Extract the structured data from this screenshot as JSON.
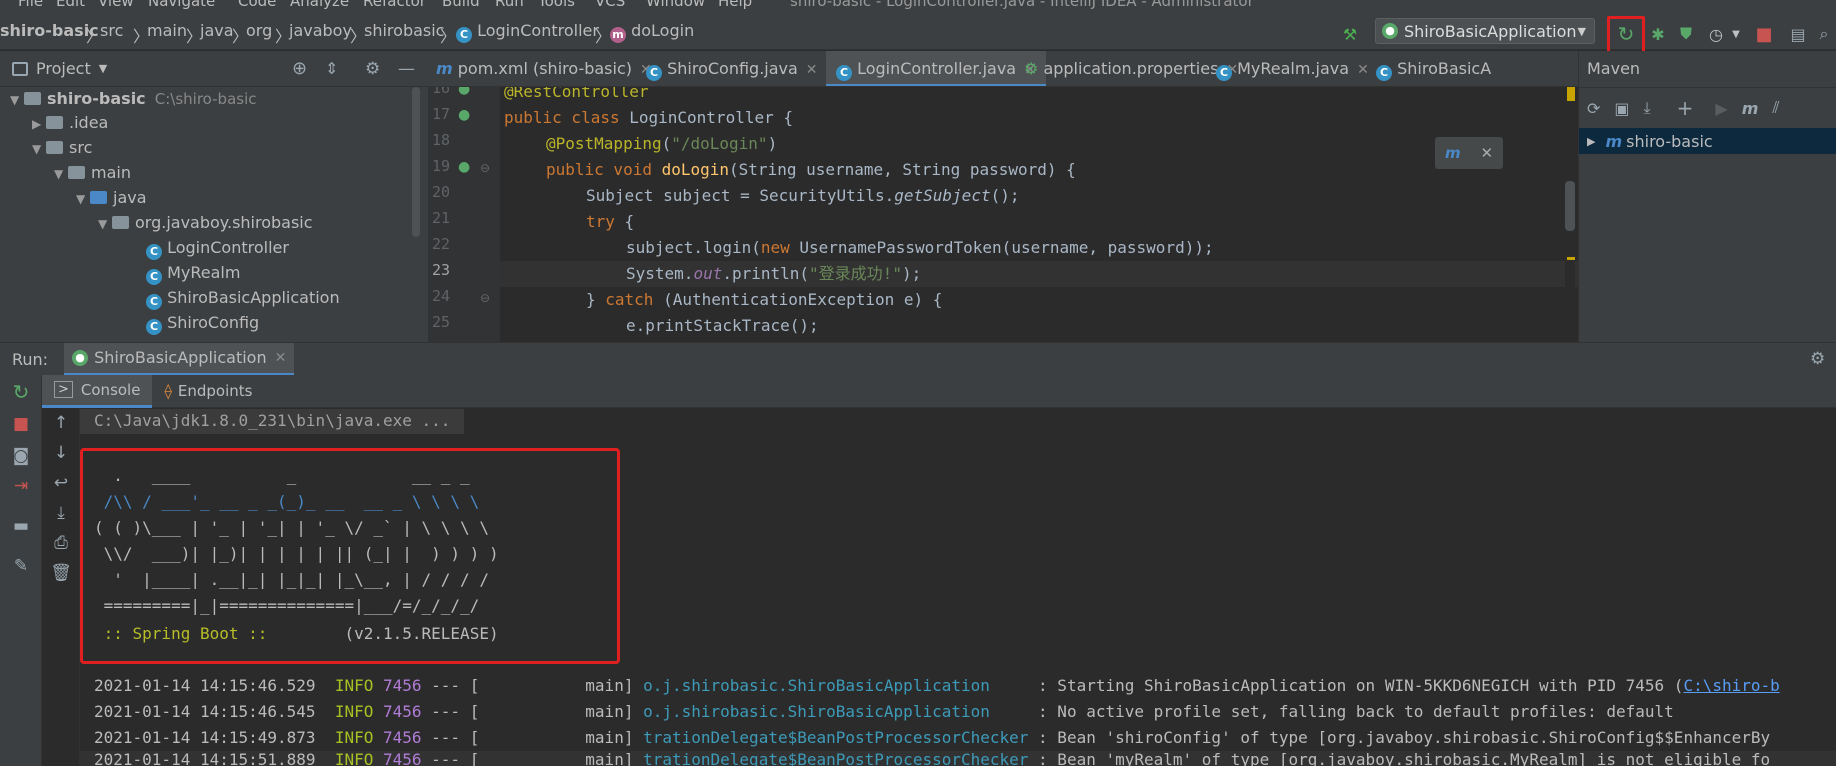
{
  "menu": [
    "File",
    "Edit",
    "View",
    "Navigate",
    "Code",
    "Analyze",
    "Refactor",
    "Build",
    "Run",
    "Tools",
    "VCS",
    "Window",
    "Help"
  ],
  "window_title": "shiro-basic - LoginController.java - IntelliJ IDEA - Administrator",
  "breadcrumb": [
    "shiro-basic",
    "src",
    "main",
    "java",
    "org",
    "javaboy",
    "shirobasic",
    "LoginController",
    "doLogin"
  ],
  "run_config": "ShiroBasicApplication",
  "project": {
    "header": "Project",
    "root_name": "shiro-basic",
    "root_path": "C:\\shiro-basic",
    "items": [
      ".idea",
      "src",
      "main",
      "java",
      "org.javaboy.shirobasic",
      "LoginController",
      "MyRealm",
      "ShiroBasicApplication",
      "ShiroConfig"
    ]
  },
  "editor": {
    "tabs": [
      "pom.xml (shiro-basic)",
      "ShiroConfig.java",
      "LoginController.java",
      "application.properties",
      "MyRealm.java",
      "ShiroBasicA"
    ],
    "line_numbers": [
      "16",
      "17",
      "18",
      "19",
      "20",
      "21",
      "22",
      "23",
      "24",
      "25"
    ],
    "lines": {
      "l16": "@RestController",
      "l17a": "public class ",
      "l17b": "LoginController {",
      "l18a": "@PostMapping",
      "l18b": "(",
      "l18c": "\"/doLogin\"",
      "l18d": ")",
      "l19a": "public void ",
      "l19b": "doLogin",
      "l19c": "(String username, String password) {",
      "l20a": "Subject subject = SecurityUtils.",
      "l20b": "getSubject",
      "l20c": "();",
      "l21a": "try ",
      "l21b": "{",
      "l22a": "subject.login(",
      "l22b": "new ",
      "l22c": "UsernamePasswordToken(username, password));",
      "l23a": "System.",
      "l23b": "out",
      "l23c": ".println(",
      "l23d": "\"登录成功!\"",
      "l23e": ");",
      "l24a": "} ",
      "l24b": "catch ",
      "l24c": "(AuthenticationException e) {",
      "l25": "e.printStackTrace();"
    }
  },
  "maven": {
    "title": "Maven",
    "project": "shiro-basic"
  },
  "run": {
    "label": "Run:",
    "tab": "ShiroBasicApplication",
    "subtabs": [
      "Console",
      "Endpoints"
    ],
    "command": "C:\\Java\\jdk1.8.0_231\\bin\\java.exe ...",
    "banner": [
      "  .   ____          _            __ _ _",
      " /\\\\ / ___'_ __ _ _(_)_ __  __ _ \\ \\ \\ \\",
      "( ( )\\___ | '_ | '_| | '_ \\/ _` | \\ \\ \\ \\",
      " \\\\/  ___)| |_)| | | | | || (_| |  ) ) ) )",
      "  '  |____| .__|_| |_|_| |_\\__, | / / / /",
      " =========|_|==============|___/=/_/_/_/"
    ],
    "spring_label": " :: Spring Boot :: ",
    "spring_version": "       (v2.1.5.RELEASE)",
    "logs": [
      {
        "ts": "2021-01-14 14:15:46.529",
        "lvl": "INFO",
        "pid": "7456",
        "thr": " --- [           main] ",
        "cls": "o.j.shirobasic.ShiroBasicApplication    ",
        "msg": " : Starting ShiroBasicApplication on WIN-5KKD6NEGICH with PID 7456 (",
        "link": "C:\\shiro-b"
      },
      {
        "ts": "2021-01-14 14:15:46.545",
        "lvl": "INFO",
        "pid": "7456",
        "thr": " --- [           main] ",
        "cls": "o.j.shirobasic.ShiroBasicApplication    ",
        "msg": " : No active profile set, falling back to default profiles: default",
        "link": ""
      },
      {
        "ts": "2021-01-14 14:15:49.873",
        "lvl": "INFO",
        "pid": "7456",
        "thr": " --- [           main] ",
        "cls": "trationDelegate$BeanPostProcessorChecker",
        "msg": " : Bean 'shiroConfig' of type [org.javaboy.shirobasic.ShiroConfig$$EnhancerBy",
        "link": ""
      },
      {
        "ts": "2021-01-14 14:15:51.889",
        "lvl": "INFO",
        "pid": "7456",
        "thr": " --- [           main] ",
        "cls": "trationDelegate$BeanPostProcessorChecker",
        "msg": " : Bean 'myRealm' of type [org.javaboy.shirobasic.MyRealm] is not eligible fo",
        "link": ""
      }
    ]
  },
  "colors": {
    "highlight": "#e02020",
    "accent": "#4a88c7",
    "bg": "#2b2b2b",
    "panel": "#3c3f41"
  }
}
